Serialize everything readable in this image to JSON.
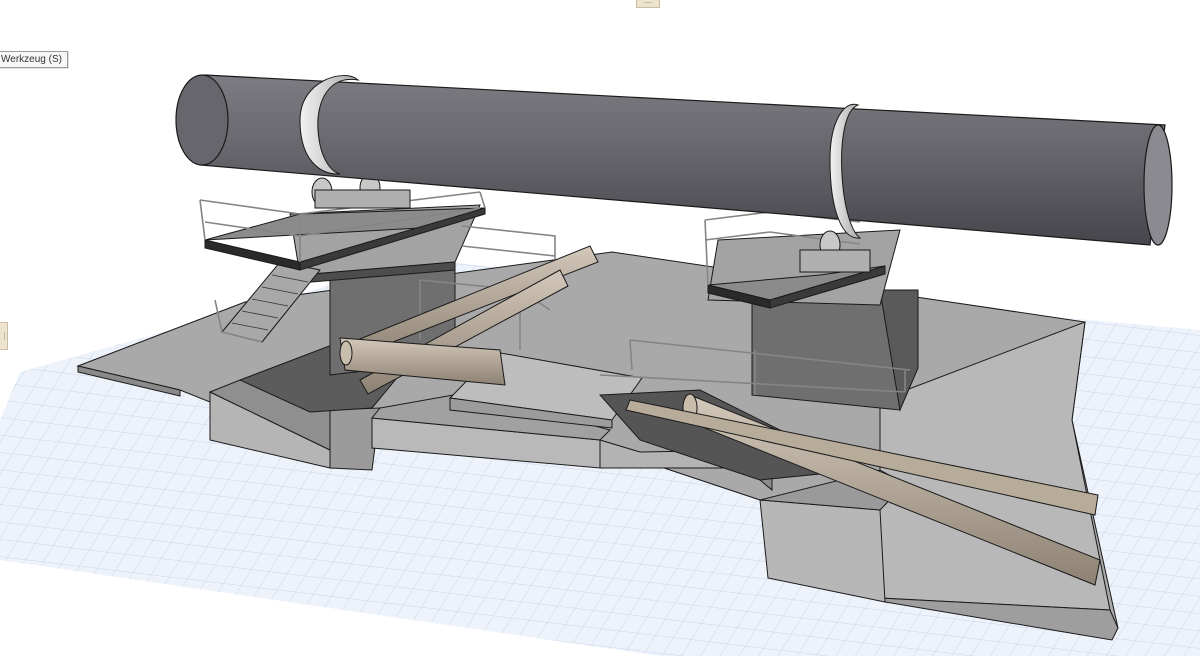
{
  "tooltip": {
    "label": "Werkzeug (S)"
  },
  "handles": {
    "top_glyph": "----",
    "side_glyph": "----"
  },
  "colors": {
    "background": "#ffffff",
    "grid_plane": "#eef3fb",
    "grid_line": "#c5d3ea",
    "slab_top": "#a9a9a9",
    "wall_light": "#b9b9b9",
    "wall_dark": "#6f6f6f",
    "kiln_drum": "#5d5d63",
    "tire_ring": "#d9d9d9",
    "timber_pipe": "#b3a695",
    "railing": "#8a8a8a",
    "edge": "#1a1a1a"
  },
  "scene": {
    "objects": [
      "rotary-kiln-drum",
      "kiln-tire-ring",
      "support-rollers",
      "platform-with-railing",
      "stair-ramp",
      "concrete-foundation",
      "timber-pipes",
      "reference-grid-plane"
    ]
  }
}
